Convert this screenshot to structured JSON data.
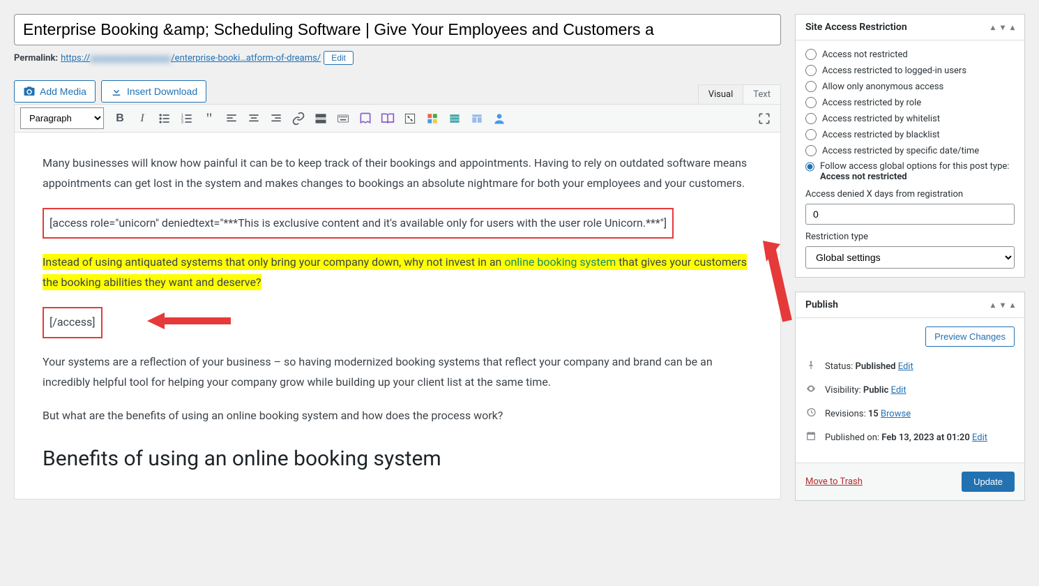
{
  "title": "Enterprise Booking &amp; Scheduling Software | Give Your Employees and Customers a",
  "permalink": {
    "label": "Permalink:",
    "url_prefix": "https://",
    "url_blur": "xxxxxxxxxxxxxxxxxx",
    "url_suffix": "/enterprise-booki…atform-of-dreams/",
    "edit": "Edit"
  },
  "buttons": {
    "add_media": "Add Media",
    "insert_download": "Insert Download"
  },
  "tabs": {
    "visual": "Visual",
    "text": "Text"
  },
  "format_select": "Paragraph",
  "content": {
    "p1": "Many businesses will know how painful it can be to keep track of their bookings and appointments. Having to rely on outdated software means appointments can get lost in the system and makes changes to bookings an absolute nightmare for both your employees and your customers.",
    "shortcode_open": "[access role=\"unicorn\" deniedtext=\"***This is exclusive content and it's available only for users with the user role Unicorn.***\"]",
    "hl_before": "Instead of using antiquated systems that only bring your company down, why not invest in an ",
    "hl_link": "online booking system",
    "hl_after": " that gives your customers the booking abilities they want and deserve?",
    "shortcode_close": "[/access]",
    "p3": "Your systems are a reflection of your business – so having modernized booking systems that reflect your company and brand can be an incredibly helpful tool for helping your company grow while building up your client list at the same time.",
    "p4": "But what are the benefits of using an online booking system and how does the process work?",
    "h2": "Benefits of using an online booking system"
  },
  "access_panel": {
    "title": "Site Access Restriction",
    "opts": [
      "Access not restricted",
      "Access restricted to logged-in users",
      "Allow only anonymous access",
      "Access restricted by role",
      "Access restricted by whitelist",
      "Access restricted by blacklist",
      "Access restricted by specific date/time"
    ],
    "opt_follow_before": "Follow access global options for this post type: ",
    "opt_follow_strong": "Access not restricted",
    "denied_label": "Access denied X days from registration",
    "denied_value": "0",
    "rtype_label": "Restriction type",
    "rtype_value": "Global settings"
  },
  "publish": {
    "title": "Publish",
    "preview": "Preview Changes",
    "status_label": "Status: ",
    "status_value": "Published",
    "visibility_label": "Visibility: ",
    "visibility_value": "Public",
    "revisions_label": "Revisions: ",
    "revisions_value": "15",
    "browse": "Browse",
    "published_label": "Published on: ",
    "published_value": "Feb 13, 2023 at 01:20",
    "edit": "Edit",
    "trash": "Move to Trash",
    "update": "Update"
  }
}
